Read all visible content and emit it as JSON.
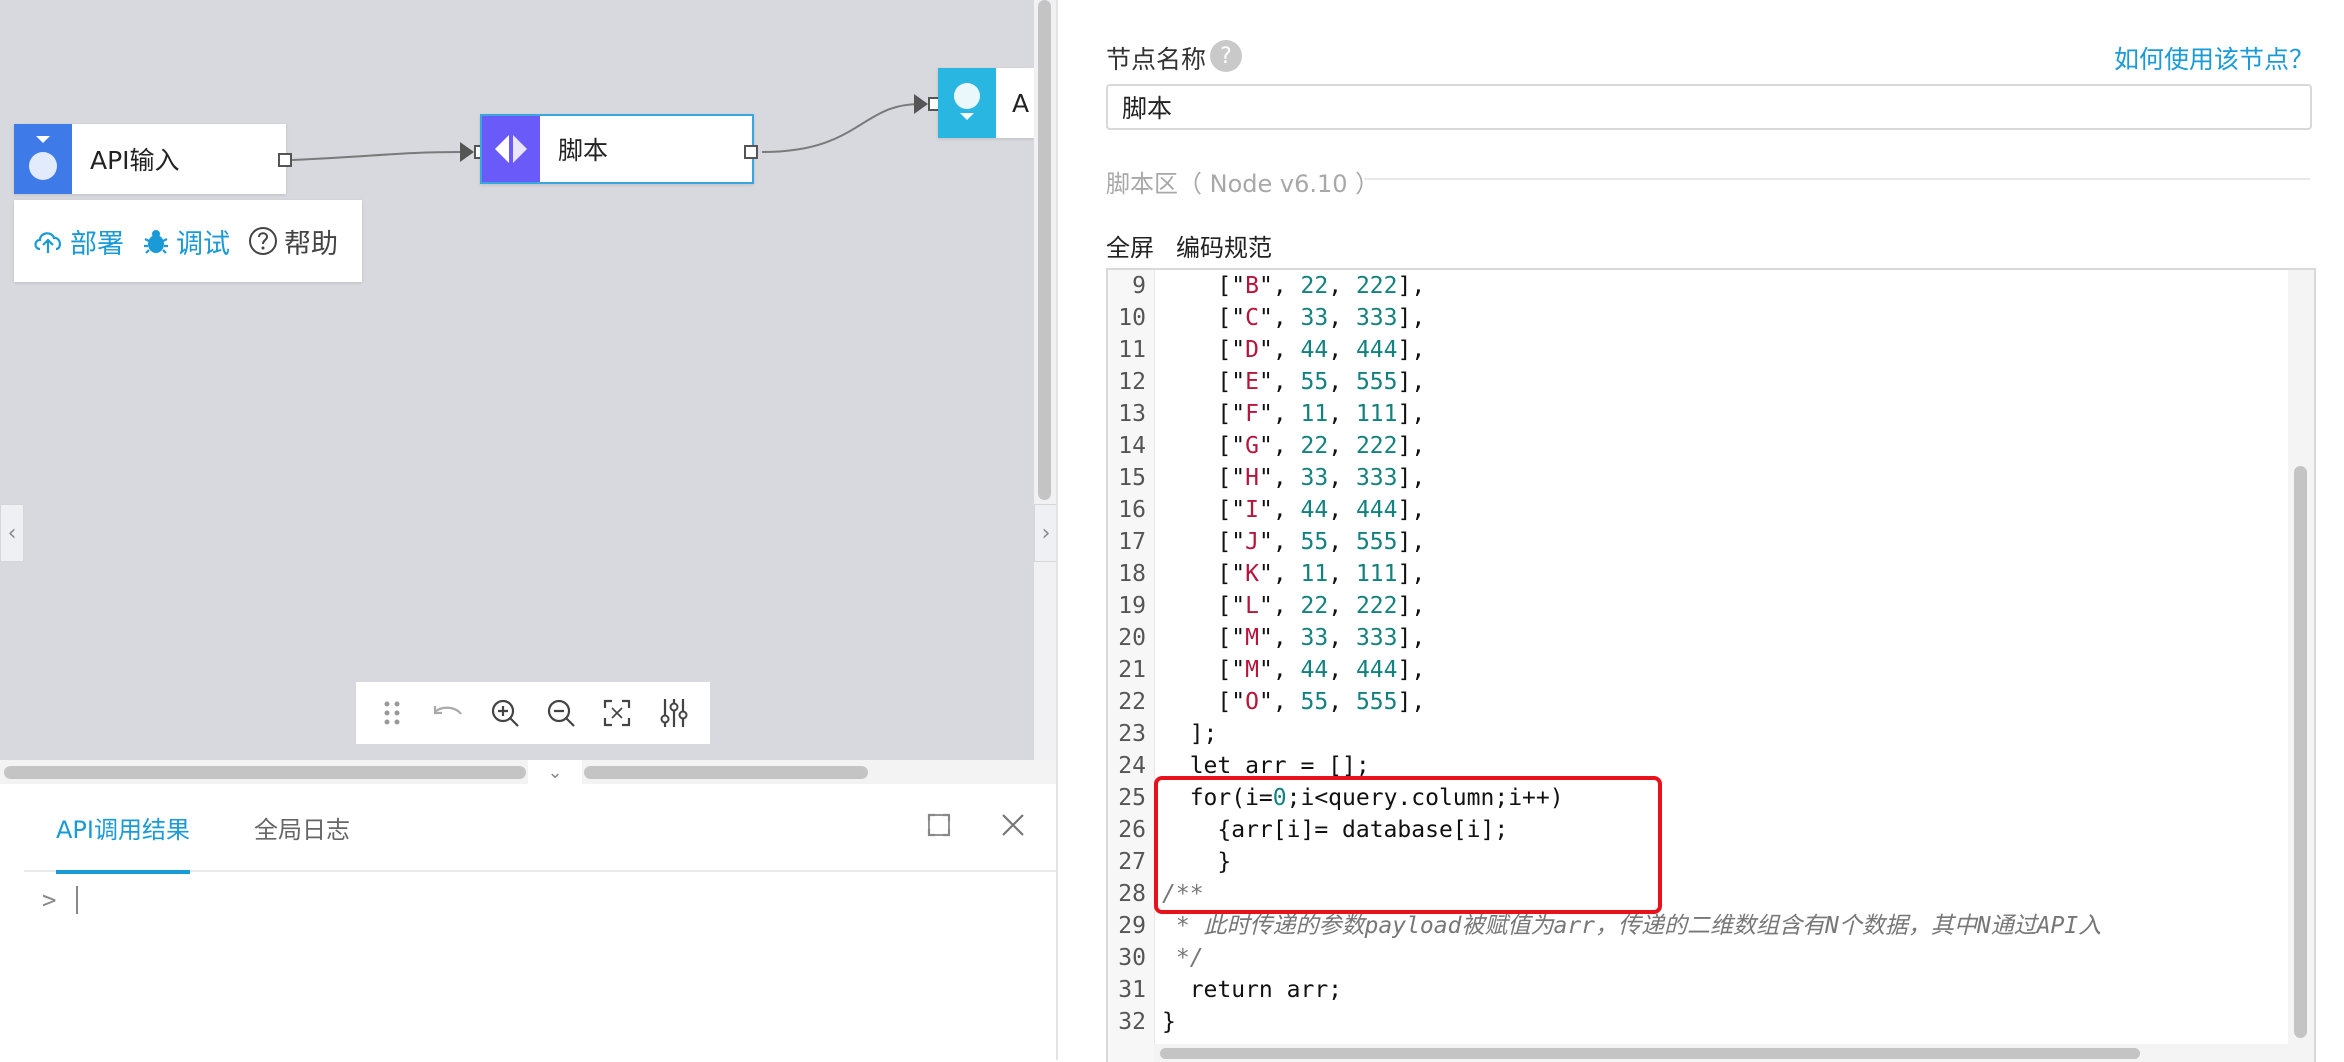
{
  "canvas": {
    "nodes": [
      {
        "label": "API输入"
      },
      {
        "label": "脚本"
      },
      {
        "label": "A"
      }
    ],
    "menu": {
      "deploy": "部署",
      "debug": "调试",
      "help": "帮助"
    },
    "toolbar_icons": [
      "drag-handle-icon",
      "undo-icon",
      "zoom-in-icon",
      "zoom-out-icon",
      "fit-screen-icon",
      "settings-sliders-icon"
    ]
  },
  "bottom_panel": {
    "tabs": [
      "API调用结果",
      "全局日志"
    ],
    "active_tab": "API调用结果",
    "prompt": ">"
  },
  "right_panel": {
    "name_label": "节点名称",
    "help_icon_text": "?",
    "howto_link": "如何使用该节点？",
    "name_value": "脚本",
    "script_section": "脚本区（ Node v6.10 ）",
    "actions": [
      "全屏",
      "编码规范"
    ]
  },
  "code": {
    "lines": [
      {
        "n": "9",
        "t": "    [\"B\", 22, 222],"
      },
      {
        "n": "10",
        "t": "    [\"C\", 33, 333],"
      },
      {
        "n": "11",
        "t": "    [\"D\", 44, 444],"
      },
      {
        "n": "12",
        "t": "    [\"E\", 55, 555],"
      },
      {
        "n": "13",
        "t": "    [\"F\", 11, 111],"
      },
      {
        "n": "14",
        "t": "    [\"G\", 22, 222],"
      },
      {
        "n": "15",
        "t": "    [\"H\", 33, 333],"
      },
      {
        "n": "16",
        "t": "    [\"I\", 44, 444],"
      },
      {
        "n": "17",
        "t": "    [\"J\", 55, 555],"
      },
      {
        "n": "18",
        "t": "    [\"K\", 11, 111],"
      },
      {
        "n": "19",
        "t": "    [\"L\", 22, 222],"
      },
      {
        "n": "20",
        "t": "    [\"M\", 33, 333],"
      },
      {
        "n": "21",
        "t": "    [\"M\", 44, 444],"
      },
      {
        "n": "22",
        "t": "    [\"O\", 55, 555],"
      },
      {
        "n": "23",
        "t": "  ];"
      },
      {
        "n": "24",
        "t": "  let arr = [];"
      },
      {
        "n": "25",
        "t": "  for(i=0;i<query.column;i++)"
      },
      {
        "n": "26",
        "t": "    {arr[i]= database[i];"
      },
      {
        "n": "27",
        "t": "    }"
      },
      {
        "n": "28",
        "t": "/**"
      },
      {
        "n": "29",
        "t": " * 此时传递的参数payload被赋值为arr，传递的二维数组含有N个数据，其中N通过API入"
      },
      {
        "n": "30",
        "t": " */"
      },
      {
        "n": "31",
        "t": "  return arr;"
      },
      {
        "n": "32",
        "t": "}"
      }
    ]
  },
  "colors": {
    "accent": "#1a9ad6",
    "highlight": "#e8121d",
    "api_node_icon": "#3f7be8",
    "script_node_icon": "#6a5af9",
    "output_node_icon": "#29b6e0"
  }
}
